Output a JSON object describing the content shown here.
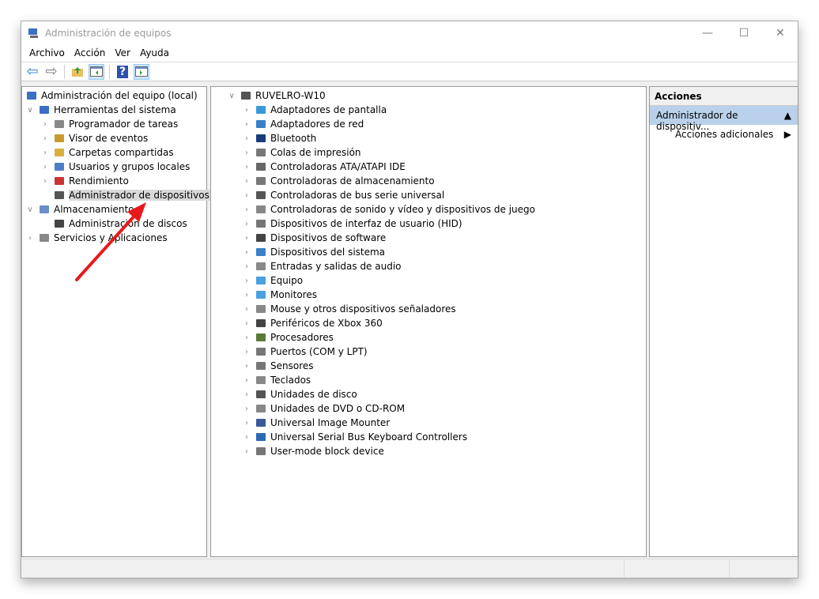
{
  "window": {
    "title": "Administración de equipos",
    "minimize": "—",
    "maximize": "☐",
    "close": "✕"
  },
  "menu": [
    "Archivo",
    "Acción",
    "Ver",
    "Ayuda"
  ],
  "toolbar": {
    "back": "⇦",
    "forward": "⇨",
    "help": "?"
  },
  "left_tree": {
    "root": "Administración del equipo (local)",
    "items": [
      {
        "label": "Herramientas del sistema",
        "level": 1,
        "expanded": true
      },
      {
        "label": "Programador de tareas",
        "level": 2
      },
      {
        "label": "Visor de eventos",
        "level": 2
      },
      {
        "label": "Carpetas compartidas",
        "level": 2
      },
      {
        "label": "Usuarios y grupos locales",
        "level": 2
      },
      {
        "label": "Rendimiento",
        "level": 2
      },
      {
        "label": "Administrador de dispositivos",
        "level": 2,
        "selected": true
      },
      {
        "label": "Almacenamiento",
        "level": 1,
        "expanded": true
      },
      {
        "label": "Administración de discos",
        "level": 2
      },
      {
        "label": "Servicios y Aplicaciones",
        "level": 1
      }
    ]
  },
  "device_tree": {
    "root": "RUVELRO-W10",
    "items": [
      "Adaptadores de pantalla",
      "Adaptadores de red",
      "Bluetooth",
      "Colas de impresión",
      "Controladoras ATA/ATAPI IDE",
      "Controladoras de almacenamiento",
      "Controladoras de bus serie universal",
      "Controladoras de sonido y vídeo y dispositivos de juego",
      "Dispositivos de interfaz de usuario (HID)",
      "Dispositivos de software",
      "Dispositivos del sistema",
      "Entradas y salidas de audio",
      "Equipo",
      "Monitores",
      "Mouse y otros dispositivos señaladores",
      "Periféricos de Xbox 360",
      "Procesadores",
      "Puertos (COM y LPT)",
      "Sensores",
      "Teclados",
      "Unidades de disco",
      "Unidades de DVD o CD-ROM",
      "Universal Image Mounter",
      "Universal Serial Bus Keyboard Controllers",
      "User-mode block device"
    ]
  },
  "actions": {
    "header": "Acciones",
    "section": "Administrador de dispositiv...",
    "item": "Acciones adicionales"
  },
  "annotation_color": "#e8191c"
}
